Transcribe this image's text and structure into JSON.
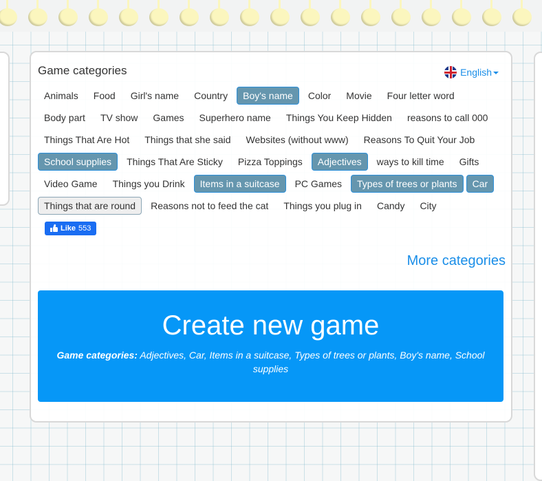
{
  "panel": {
    "title": "Game categories",
    "language": {
      "label": "English",
      "flag_icon": "uk-flag-icon"
    }
  },
  "categories": [
    {
      "label": "Animals",
      "state": "normal"
    },
    {
      "label": "Food",
      "state": "normal"
    },
    {
      "label": "Girl's name",
      "state": "normal"
    },
    {
      "label": "Country",
      "state": "normal"
    },
    {
      "label": "Boy's name",
      "state": "selected"
    },
    {
      "label": "Color",
      "state": "normal"
    },
    {
      "label": "Movie",
      "state": "normal"
    },
    {
      "label": "Four letter word",
      "state": "normal"
    },
    {
      "label": "Body part",
      "state": "normal"
    },
    {
      "label": "TV show",
      "state": "normal"
    },
    {
      "label": "Games",
      "state": "normal"
    },
    {
      "label": "Superhero name",
      "state": "normal"
    },
    {
      "label": "Things You Keep Hidden",
      "state": "normal"
    },
    {
      "label": "reasons to call 000",
      "state": "normal"
    },
    {
      "label": "Things That Are Hot",
      "state": "normal"
    },
    {
      "label": "Things that she said",
      "state": "normal"
    },
    {
      "label": "Websites (without www)",
      "state": "normal"
    },
    {
      "label": "Reasons To Quit Your Job",
      "state": "normal"
    },
    {
      "label": "School supplies",
      "state": "selected"
    },
    {
      "label": "Things That Are Sticky",
      "state": "normal"
    },
    {
      "label": "Pizza Toppings",
      "state": "normal"
    },
    {
      "label": "Adjectives",
      "state": "selected"
    },
    {
      "label": "ways to kill time",
      "state": "normal"
    },
    {
      "label": "Gifts",
      "state": "normal"
    },
    {
      "label": "Video Game",
      "state": "normal"
    },
    {
      "label": "Things you Drink",
      "state": "normal"
    },
    {
      "label": "Items in a suitcase",
      "state": "selected"
    },
    {
      "label": "PC Games",
      "state": "normal"
    },
    {
      "label": "Types of trees or plants",
      "state": "selected"
    },
    {
      "label": "Car",
      "state": "selected"
    },
    {
      "label": "Things that are round",
      "state": "hover"
    },
    {
      "label": "Reasons not to feed the cat",
      "state": "normal"
    },
    {
      "label": "Things you plug in",
      "state": "normal"
    },
    {
      "label": "Candy",
      "state": "normal"
    },
    {
      "label": "City",
      "state": "normal"
    }
  ],
  "like": {
    "label": "Like",
    "count": "553"
  },
  "more_categories": "More categories",
  "create": {
    "title": "Create new game",
    "sub_label": "Game categories:",
    "sub_value": " Adjectives, Car, Items in a suitcase, Types of trees or plants, Boy's name, School supplies"
  },
  "colors": {
    "accent": "#0697f7",
    "selected_bg": "#6596ae",
    "link": "#1a8ee8",
    "facebook": "#1a6df2"
  }
}
